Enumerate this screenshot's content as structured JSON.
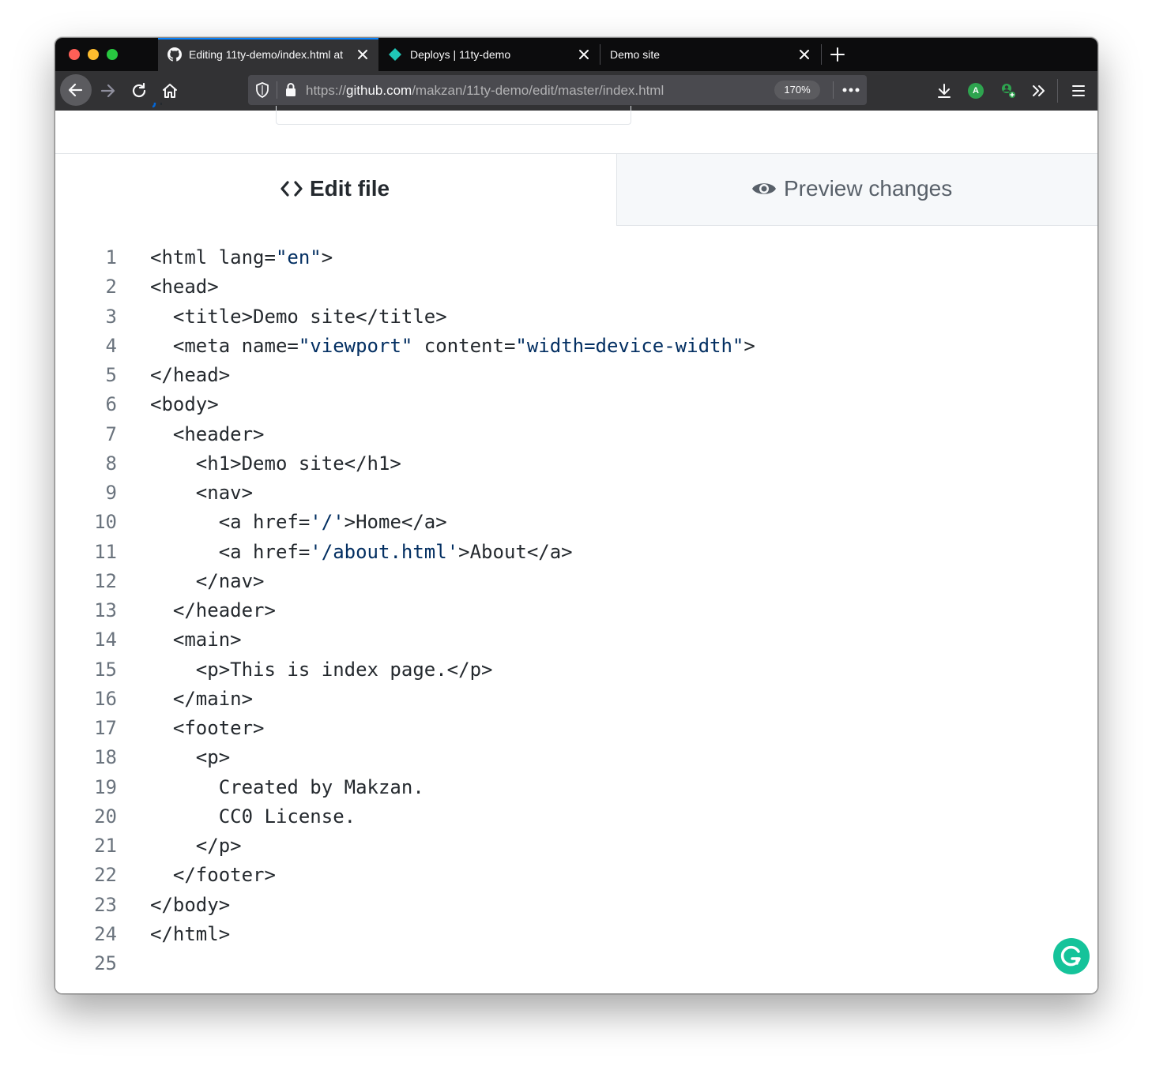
{
  "browser": {
    "tabs": [
      {
        "label": "Editing 11ty-demo/index.html at",
        "icon": "github-icon",
        "active": true
      },
      {
        "label": "Deploys | 11ty-demo",
        "icon": "netlify-icon",
        "active": false
      },
      {
        "label": "Demo site",
        "icon": "",
        "active": false
      }
    ],
    "url": {
      "scheme": "https://",
      "host": "github.com",
      "path": "/makzan/11ty-demo/edit/master/index.html"
    },
    "zoom": "170%",
    "extension_badge": "A"
  },
  "editor": {
    "edit_tab_label": "Edit file",
    "preview_tab_label": "Preview changes",
    "lines": [
      {
        "n": "1",
        "segments": [
          {
            "t": "<html lang="
          },
          {
            "t": "\"en\"",
            "s": true
          },
          {
            "t": ">"
          }
        ]
      },
      {
        "n": "2",
        "segments": [
          {
            "t": "<head>"
          }
        ]
      },
      {
        "n": "3",
        "segments": [
          {
            "t": "  <title>Demo site</title>"
          }
        ]
      },
      {
        "n": "4",
        "segments": [
          {
            "t": "  <meta name="
          },
          {
            "t": "\"viewport\"",
            "s": true
          },
          {
            "t": " content="
          },
          {
            "t": "\"width=device-width\"",
            "s": true
          },
          {
            "t": ">"
          }
        ]
      },
      {
        "n": "5",
        "segments": [
          {
            "t": "</head>"
          }
        ]
      },
      {
        "n": "6",
        "segments": [
          {
            "t": "<body>"
          }
        ]
      },
      {
        "n": "7",
        "segments": [
          {
            "t": "  <header>"
          }
        ]
      },
      {
        "n": "8",
        "segments": [
          {
            "t": "    <h1>Demo site</h1>"
          }
        ]
      },
      {
        "n": "9",
        "segments": [
          {
            "t": "    <nav>"
          }
        ]
      },
      {
        "n": "10",
        "segments": [
          {
            "t": "      <a href="
          },
          {
            "t": "'/'",
            "s": true
          },
          {
            "t": ">Home</a>"
          }
        ]
      },
      {
        "n": "11",
        "segments": [
          {
            "t": "      <a href="
          },
          {
            "t": "'/about.html'",
            "s": true
          },
          {
            "t": ">About</a>"
          }
        ]
      },
      {
        "n": "12",
        "segments": [
          {
            "t": "    </nav>"
          }
        ]
      },
      {
        "n": "13",
        "segments": [
          {
            "t": "  </header>"
          }
        ]
      },
      {
        "n": "14",
        "segments": [
          {
            "t": "  <main>"
          }
        ]
      },
      {
        "n": "15",
        "segments": [
          {
            "t": "    <p>This is index page.</p>"
          }
        ]
      },
      {
        "n": "16",
        "segments": [
          {
            "t": "  </main>"
          }
        ]
      },
      {
        "n": "17",
        "segments": [
          {
            "t": "  <footer>"
          }
        ]
      },
      {
        "n": "18",
        "segments": [
          {
            "t": "    <p>"
          }
        ]
      },
      {
        "n": "19",
        "segments": [
          {
            "t": "      Created by Makzan."
          }
        ]
      },
      {
        "n": "20",
        "segments": [
          {
            "t": "      CC0 License."
          }
        ]
      },
      {
        "n": "21",
        "segments": [
          {
            "t": "    </p>"
          }
        ]
      },
      {
        "n": "22",
        "segments": [
          {
            "t": "  </footer>"
          }
        ]
      },
      {
        "n": "23",
        "segments": [
          {
            "t": "</body>"
          }
        ]
      },
      {
        "n": "24",
        "segments": [
          {
            "t": "</html>"
          }
        ]
      },
      {
        "n": "25",
        "segments": [
          {
            "t": ""
          }
        ]
      }
    ]
  },
  "colors": {
    "accent_tab": "#0a84ff",
    "string": "#032f62",
    "grammarly": "#15c39a",
    "extension_green": "#2ea44f"
  }
}
